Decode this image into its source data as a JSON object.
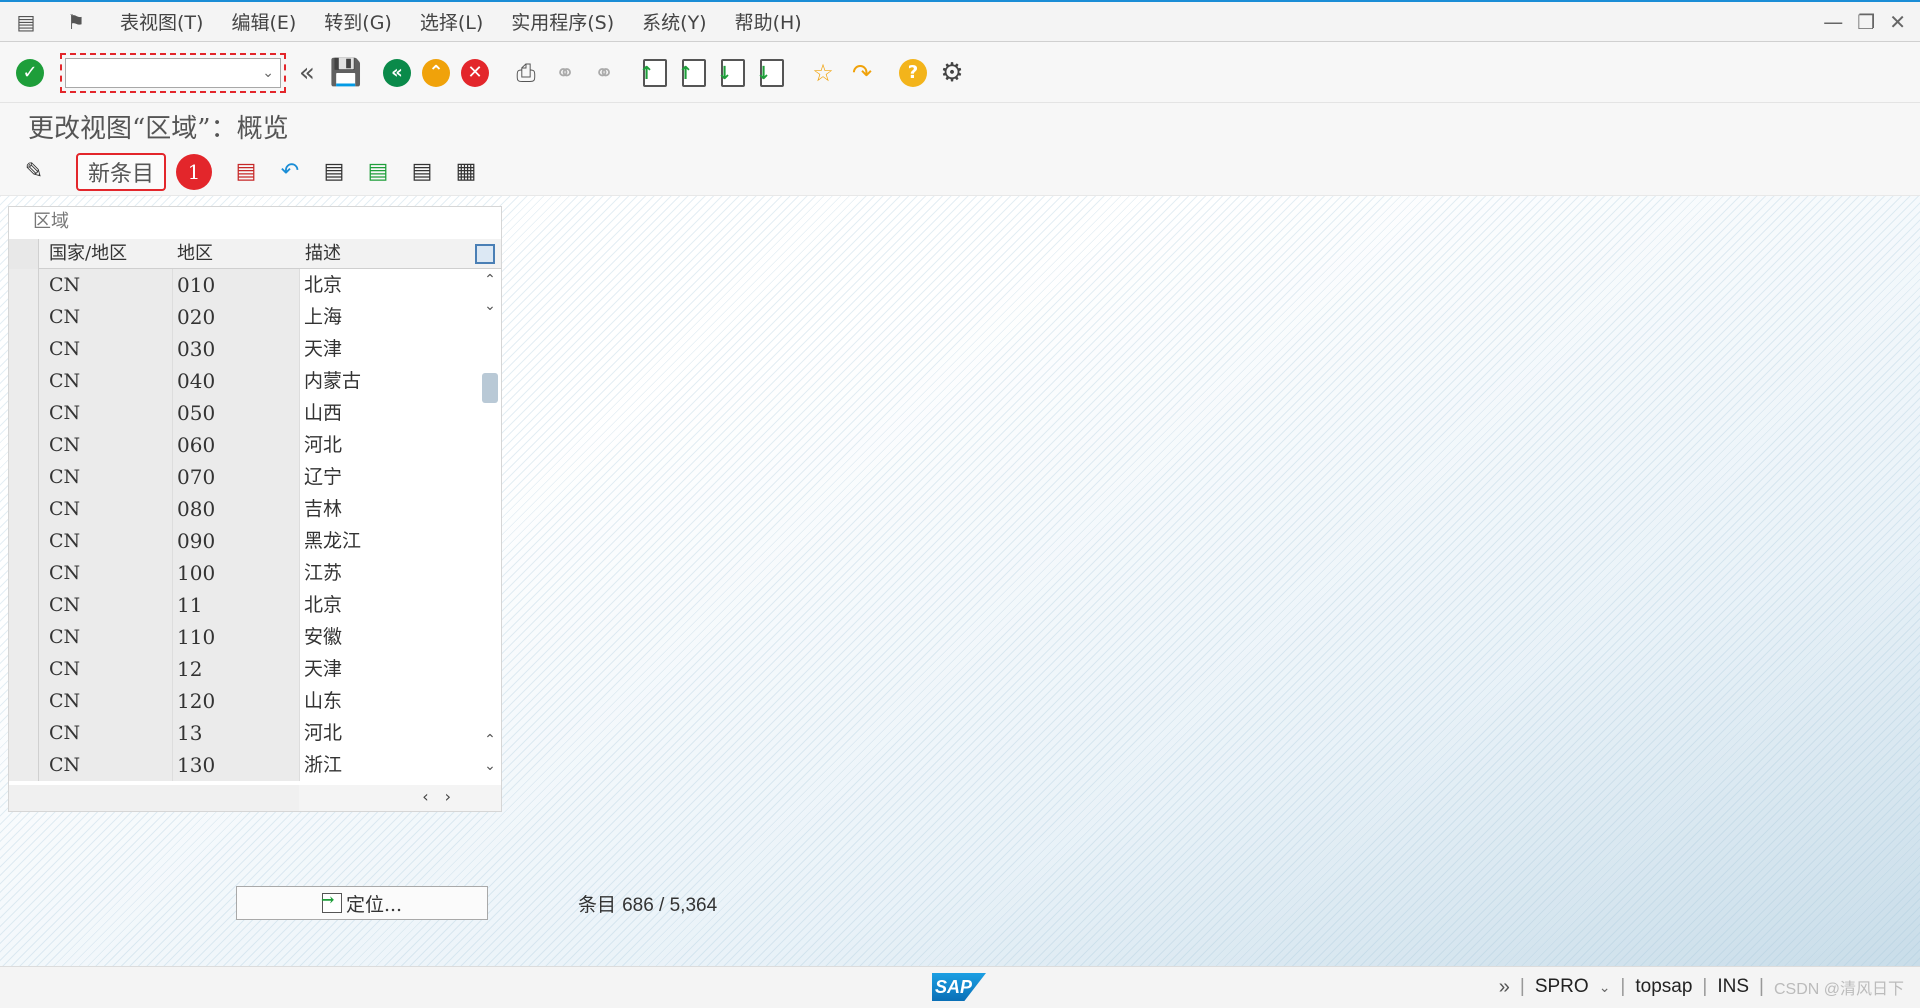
{
  "menu": {
    "items": [
      "表视图(T)",
      "编辑(E)",
      "转到(G)",
      "选择(L)",
      "实用程序(S)",
      "系统(Y)",
      "帮助(H)"
    ]
  },
  "toolbar": {
    "command_value": "",
    "icons": [
      "check-icon",
      "back-double-icon",
      "save-icon",
      "back-icon",
      "exit-icon",
      "cancel-icon",
      "print-icon",
      "find-icon",
      "find-next-icon",
      "first-page-icon",
      "previous-page-icon",
      "next-page-icon",
      "last-page-icon",
      "create-session-icon",
      "shortcut-icon",
      "help-icon",
      "settings-icon"
    ]
  },
  "page": {
    "title": "更改视图“区域”：概览"
  },
  "app_toolbar": {
    "new_entry_label": "新条目",
    "step_badge": "1"
  },
  "grid": {
    "caption": "区域",
    "columns": [
      "国家/地区",
      "地区",
      "描述"
    ],
    "rows": [
      {
        "country": "CN",
        "region": "010",
        "desc": "北京"
      },
      {
        "country": "CN",
        "region": "020",
        "desc": "上海"
      },
      {
        "country": "CN",
        "region": "030",
        "desc": "天津"
      },
      {
        "country": "CN",
        "region": "040",
        "desc": "内蒙古"
      },
      {
        "country": "CN",
        "region": "050",
        "desc": "山西"
      },
      {
        "country": "CN",
        "region": "060",
        "desc": "河北"
      },
      {
        "country": "CN",
        "region": "070",
        "desc": "辽宁"
      },
      {
        "country": "CN",
        "region": "080",
        "desc": "吉林"
      },
      {
        "country": "CN",
        "region": "090",
        "desc": "黑龙江"
      },
      {
        "country": "CN",
        "region": "100",
        "desc": "江苏"
      },
      {
        "country": "CN",
        "region": "11",
        "desc": "北京"
      },
      {
        "country": "CN",
        "region": "110",
        "desc": "安徽"
      },
      {
        "country": "CN",
        "region": "12",
        "desc": "天津"
      },
      {
        "country": "CN",
        "region": "120",
        "desc": "山东"
      },
      {
        "country": "CN",
        "region": "13",
        "desc": "河北"
      },
      {
        "country": "CN",
        "region": "130",
        "desc": "浙江"
      }
    ]
  },
  "footer": {
    "locate_label": "定位...",
    "entry_label": "条目",
    "entry_value": "686 / 5,364"
  },
  "status": {
    "transaction": "SPRO",
    "user": "topsap",
    "mode": "INS",
    "watermark": "CSDN @清风日下"
  }
}
